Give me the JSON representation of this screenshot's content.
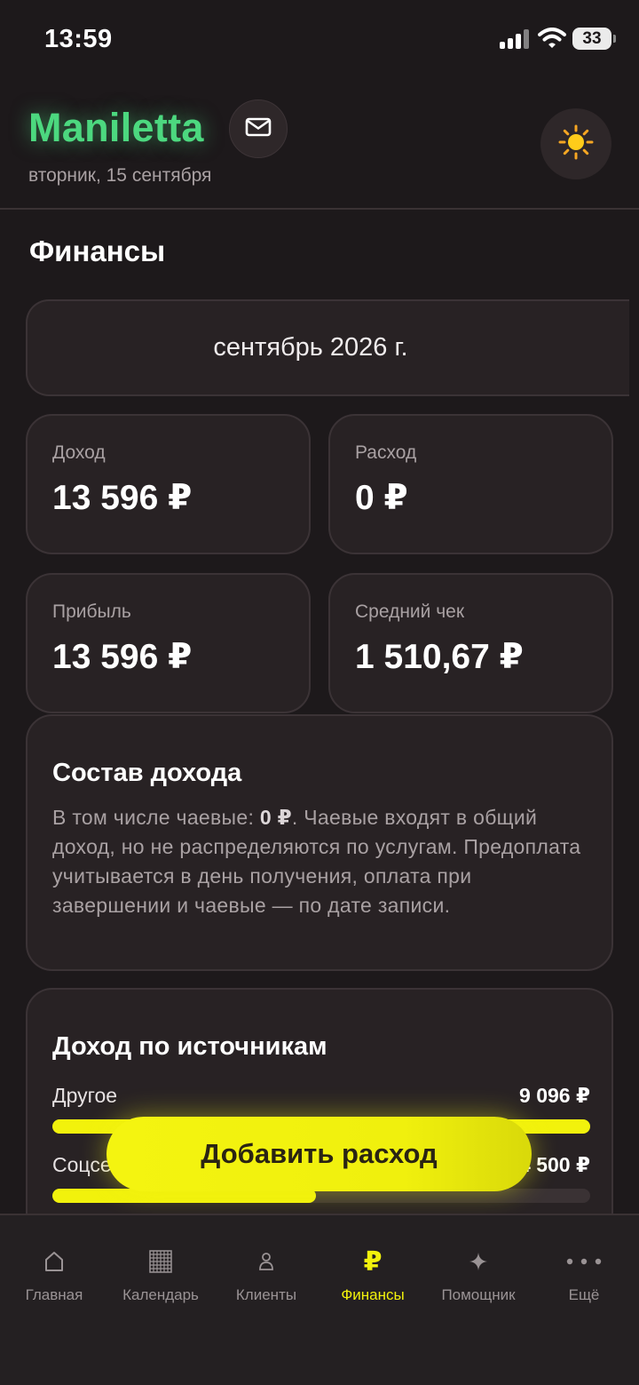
{
  "status_bar": {
    "time": "13:59",
    "battery": "33"
  },
  "header": {
    "brand": "Maniletta",
    "date": "вторник, 15 сентября",
    "icons": {
      "mail": "mail-icon",
      "theme": "sun-icon"
    },
    "brand_color": "#4cd87f"
  },
  "page": {
    "title": "Финансы"
  },
  "period": {
    "label": "сентябрь 2026 г."
  },
  "stats": [
    {
      "label": "Доход",
      "value": "13 596 ₽"
    },
    {
      "label": "Расход",
      "value": "0 ₽"
    },
    {
      "label": "Прибыль",
      "value": "13 596 ₽"
    },
    {
      "label": "Средний чек",
      "value": "1 510,67 ₽"
    }
  ],
  "income_composition": {
    "title": "Состав дохода",
    "text_before": "В том числе чаевые: ",
    "tips_value": "0 ₽",
    "text_after": ". Чаевые входят в общий доход, но не распределяются по услугам. Предоплата учитывается в день получения, оплата при завершении и чаевые — по дате записи."
  },
  "income_sources": {
    "title": "Доход по источникам",
    "items": [
      {
        "name": "Другое",
        "value": "9 096 ₽",
        "share": 1.0
      },
      {
        "name": "Соцсети",
        "value": "4 500 ₽",
        "share": 0.49
      }
    ]
  },
  "fab": {
    "label": "Добавить расход"
  },
  "tabbar": {
    "items": [
      {
        "label": "Главная",
        "icon": "home-icon",
        "active": false
      },
      {
        "label": "Календарь",
        "icon": "calendar-icon",
        "active": false
      },
      {
        "label": "Клиенты",
        "icon": "clients-icon",
        "active": false
      },
      {
        "label": "Финансы",
        "icon": "ruble-icon",
        "active": true
      },
      {
        "label": "Помощник",
        "icon": "sparkle-icon",
        "active": false
      },
      {
        "label": "Ещё",
        "icon": "more-icon",
        "active": false
      }
    ]
  },
  "colors": {
    "accent": "#f2f20c",
    "background": "#1d191b",
    "card": "#282224"
  }
}
